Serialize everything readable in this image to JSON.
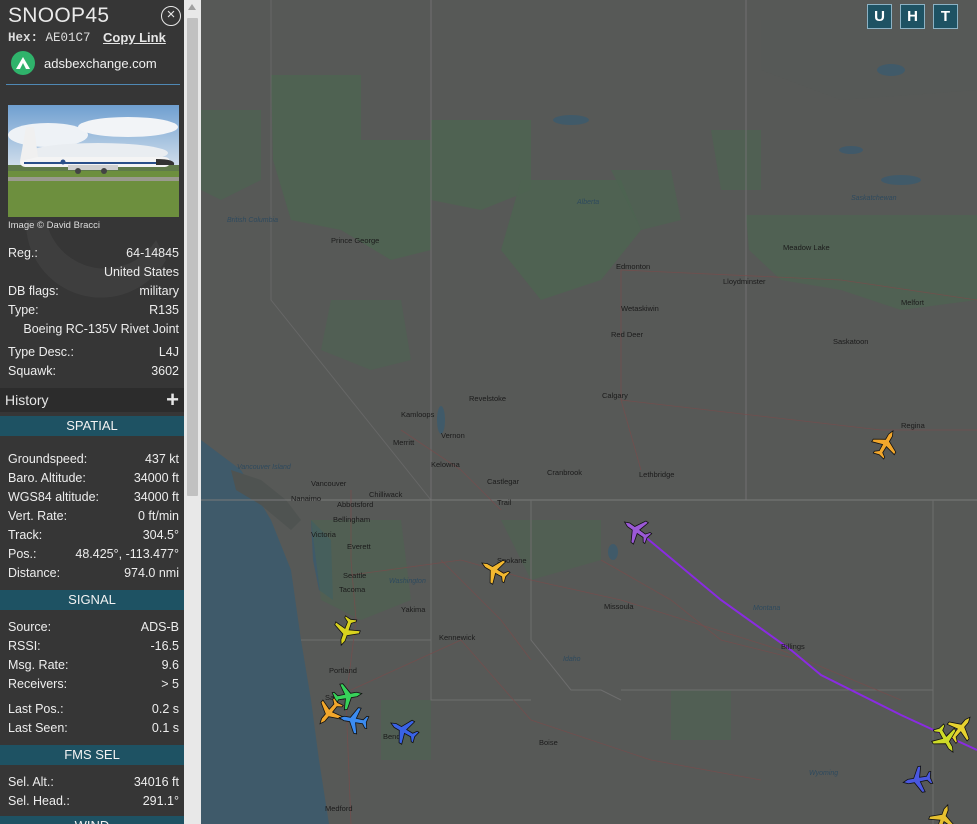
{
  "aircraft": {
    "callsign": "SNOOP45",
    "hex_label": "Hex:",
    "hex": "AE01C7",
    "copy_link": "Copy Link",
    "source": "adsbexchange.com",
    "image_credit": "Image © David Bracci"
  },
  "details": [
    {
      "k": "Reg.:",
      "v": "64-14845"
    },
    {
      "k": "",
      "v": "United States"
    },
    {
      "k": "DB flags:",
      "v": "military"
    },
    {
      "k": "Type:",
      "v": "R135"
    },
    {
      "k": "",
      "v": "Boeing RC-135V Rivet Joint"
    },
    {
      "k": "Type Desc.:",
      "v": "L4J"
    },
    {
      "k": "Squawk:",
      "v": "3602"
    }
  ],
  "history": {
    "label": "History",
    "toggle": "+"
  },
  "spatial": {
    "title": "SPATIAL",
    "rows": [
      {
        "k": "Groundspeed:",
        "v": "437 kt"
      },
      {
        "k": "Baro. Altitude:",
        "v": "34000 ft"
      },
      {
        "k": "WGS84 altitude:",
        "v": "34000 ft"
      },
      {
        "k": "Vert. Rate:",
        "v": "0 ft/min"
      },
      {
        "k": "Track:",
        "v": "304.5°"
      },
      {
        "k": "Pos.:",
        "v": "48.425°, -113.477°"
      },
      {
        "k": "Distance:",
        "v": "974.0 nmi"
      }
    ]
  },
  "signal": {
    "title": "SIGNAL",
    "rows": [
      {
        "k": "Source:",
        "v": "ADS-B"
      },
      {
        "k": "RSSI:",
        "v": "-16.5"
      },
      {
        "k": "Msg. Rate:",
        "v": "9.6"
      },
      {
        "k": "Receivers:",
        "v": "> 5"
      },
      {
        "k": "Last Pos.:",
        "v": "0.2 s"
      },
      {
        "k": "Last Seen:",
        "v": "0.1 s"
      }
    ]
  },
  "fms": {
    "title": "FMS SEL",
    "rows": [
      {
        "k": "Sel. Alt.:",
        "v": "34016 ft"
      },
      {
        "k": "Sel. Head.:",
        "v": "291.1°"
      }
    ]
  },
  "next_section": "WIND",
  "map_buttons": [
    "U",
    "H",
    "T"
  ],
  "map_labels": {
    "cities": [
      "Prince George",
      "Edmonton",
      "Lloydminster",
      "Meadow Lake",
      "Saskatoon",
      "Melfort",
      "Red Deer",
      "Wetaskiwin",
      "Calgary",
      "Regina",
      "Revelstoke",
      "Kamloops",
      "Vernon",
      "Merritt",
      "Kelowna",
      "Cranbrook",
      "Lethbridge",
      "Castlegar",
      "Trail",
      "Vancouver",
      "Chilliwack",
      "Abbotsford",
      "Nanaimo",
      "Victoria",
      "Bellingham",
      "Everett",
      "Seattle",
      "Tacoma",
      "Spokane",
      "Yakima",
      "Kennewick",
      "Missoula",
      "Portland",
      "Salem",
      "Bend",
      "Boise",
      "Billings",
      "Medford"
    ],
    "regions": [
      "British Columbia",
      "Alberta",
      "Saskatchewan",
      "Vancouver Island",
      "Washington",
      "Montana",
      "Idaho",
      "Wyoming"
    ]
  },
  "colors": {
    "sidebar_bg": "#363636",
    "section_header": "#1e5263",
    "track_line": "#8a2be2",
    "selected_plane": "#9b59d6"
  }
}
